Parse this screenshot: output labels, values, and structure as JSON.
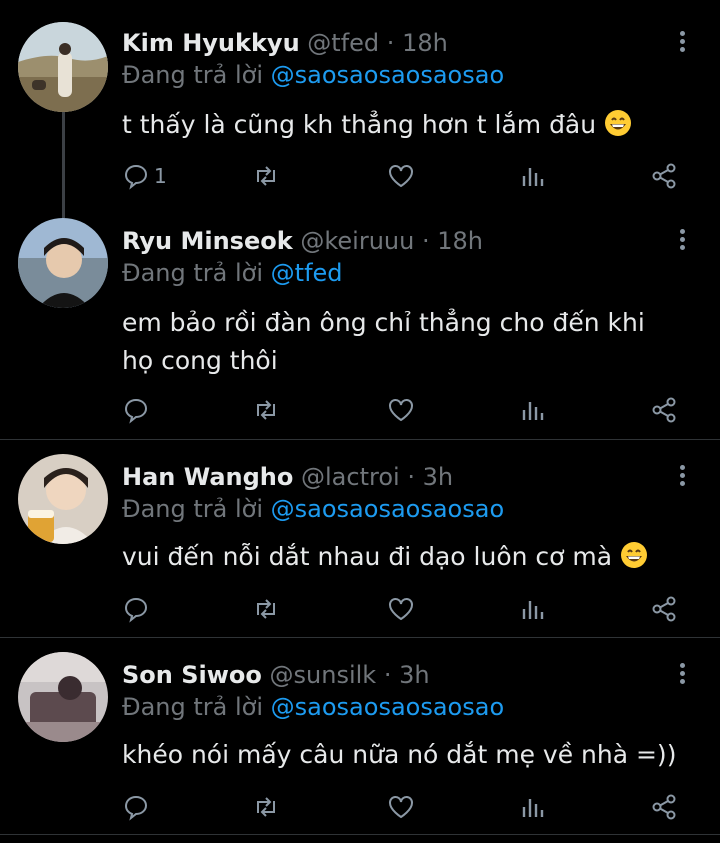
{
  "tweets": [
    {
      "name": "Kim Hyukkyu",
      "handle": "@tfed",
      "sep": "·",
      "time": "18h",
      "reply_prefix": "Đang trả lời",
      "reply_to": "@saosaosaosaosao",
      "text": "t thấy là cũng kh thẳng hơn t lắm đâu",
      "emoji": "grinning-face-emoji",
      "reply_count": "1"
    },
    {
      "name": "Ryu Minseok",
      "handle": "@keiruuu",
      "sep": "·",
      "time": "18h",
      "reply_prefix": "Đang trả lời",
      "reply_to": "@tfed",
      "text": "em bảo rồi đàn ông chỉ thẳng cho đến khi họ cong thôi",
      "reply_count": ""
    },
    {
      "name": "Han Wangho",
      "handle": "@lactroi",
      "sep": "·",
      "time": "3h",
      "reply_prefix": "Đang trả lời",
      "reply_to": "@saosaosaosaosao",
      "text": "vui đến nỗi dắt nhau đi dạo luôn cơ mà",
      "emoji": "grinning-face-emoji",
      "reply_count": ""
    },
    {
      "name": "Son Siwoo",
      "handle": "@sunsilk",
      "sep": "·",
      "time": "3h",
      "reply_prefix": "Đang trả lời",
      "reply_to": "@saosaosaosaosao",
      "text": "khéo nói mấy câu nữa nó dắt mẹ về nhà =))",
      "reply_count": ""
    }
  ],
  "icons": {
    "reply": "reply-icon",
    "retweet": "retweet-icon",
    "like": "heart-icon",
    "views": "views-icon",
    "share": "share-icon",
    "more": "more-vertical-icon"
  },
  "colors": {
    "background": "#000000",
    "name": "#e7e9ea",
    "meta": "#71767b",
    "mention": "#1d9bf0",
    "icon": "#8b98a5",
    "divider": "#2f3336"
  }
}
